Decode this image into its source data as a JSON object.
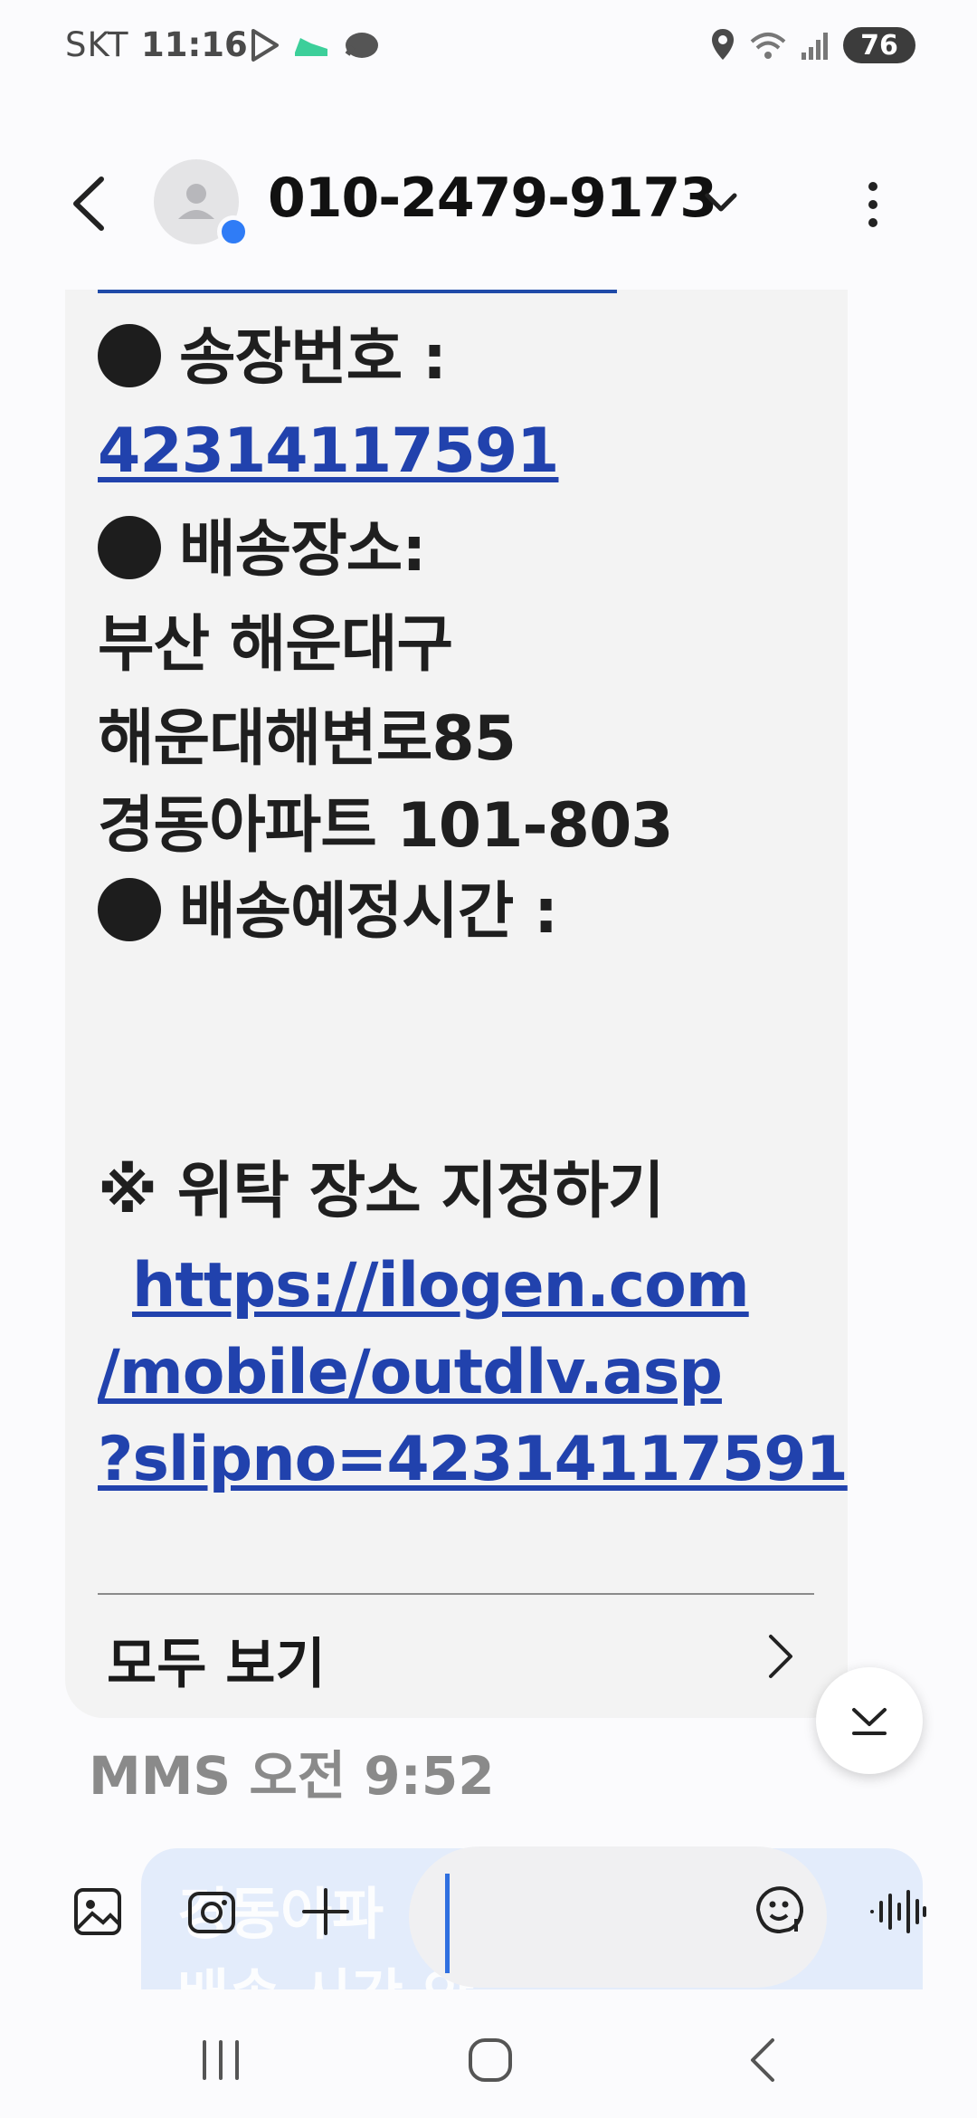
{
  "status_bar": {
    "carrier": "SKT",
    "time": "11:16",
    "battery": "76",
    "icons": [
      "play-store-icon",
      "sneaker-icon",
      "cloud-icon",
      "location-icon",
      "wifi-icon",
      "signal-icon",
      "battery-icon"
    ]
  },
  "header": {
    "title": "010-2479-9173",
    "back_icon": "back-arrow-icon",
    "dropdown_icon": "chevron-down-icon",
    "more_icon": "more-vertical-icon"
  },
  "message": {
    "lines": [
      {
        "text": "송장번호 :",
        "bullet": true
      },
      {
        "text": "42314117591",
        "link": true
      },
      {
        "text": "배송장소:",
        "bullet": true
      },
      {
        "text": "부산 해운대구"
      },
      {
        "text": "해운대해변로85"
      },
      {
        "text": "경동아파트 101-803"
      },
      {
        "text": "배송예정시간 :",
        "bullet": true
      },
      {
        "text": "※ 위탁 장소 지정하기"
      },
      {
        "text": "https://ilogen.com",
        "link": true
      },
      {
        "text": "/mobile/outdlv.asp",
        "link": true
      },
      {
        "text": "?slipno=42314117591",
        "link": true
      }
    ],
    "view_all": "모두 보기",
    "meta": "MMS 오전 9:52"
  },
  "compose": {
    "preview_line1": "경동아파",
    "preview_line2": "배송 시간 안 ...",
    "icons": [
      "gallery-icon",
      "camera-icon",
      "plus-icon",
      "sticker-icon",
      "voice-icon"
    ]
  },
  "nav_bar": {
    "icons": [
      "recents-icon",
      "home-icon",
      "back-icon"
    ]
  }
}
